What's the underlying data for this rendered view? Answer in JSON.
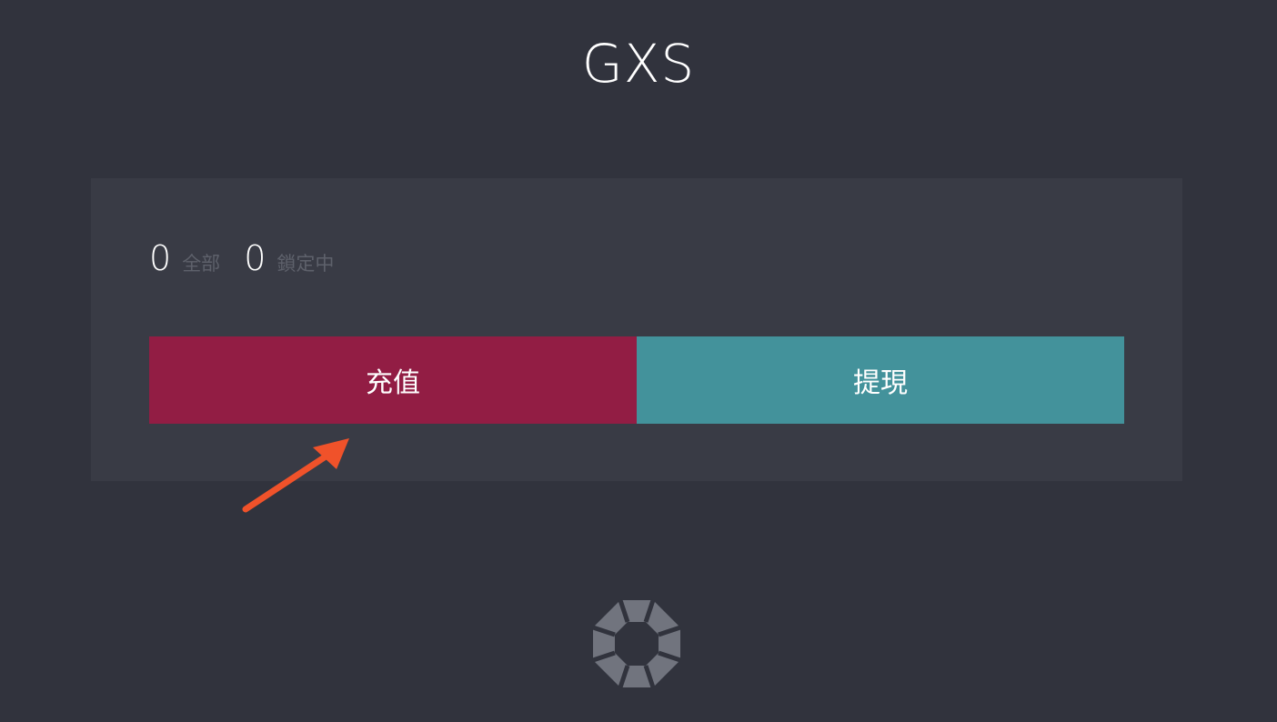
{
  "header": {
    "title": "GXS"
  },
  "balances": {
    "total_value": "0",
    "total_label": "全部",
    "locked_value": "0",
    "locked_label": "鎖定中"
  },
  "actions": {
    "deposit_label": "充值",
    "withdraw_label": "提現"
  },
  "colors": {
    "background": "#31333d",
    "card": "#393b45",
    "deposit": "#921d44",
    "withdraw": "#43929b",
    "annotation_arrow": "#f0522a",
    "logo": "#71747e"
  },
  "icons": {
    "annotation": "arrow-pointer-icon",
    "footer": "aperture-logo-icon"
  }
}
